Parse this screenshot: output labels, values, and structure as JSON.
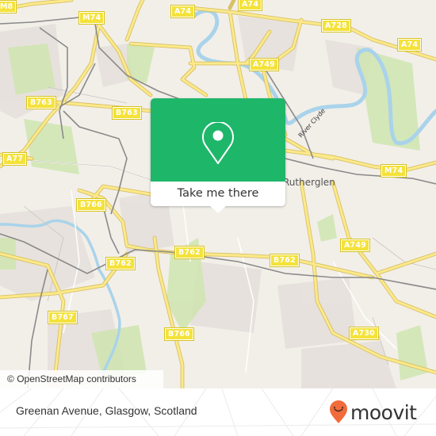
{
  "map": {
    "place_labels": [
      {
        "id": "rutherglen",
        "text": "Rutherglen"
      }
    ],
    "river_label": "River Clyde",
    "road_labels": [
      {
        "id": "m8",
        "text": "M8"
      },
      {
        "id": "m74-north",
        "text": "M74"
      },
      {
        "id": "a74-top-left",
        "text": "A74"
      },
      {
        "id": "a74-top-mid",
        "text": "A74"
      },
      {
        "id": "a728",
        "text": "A728"
      },
      {
        "id": "a74-right",
        "text": "A74"
      },
      {
        "id": "a749-top",
        "text": "A749"
      },
      {
        "id": "b763-left",
        "text": "B763"
      },
      {
        "id": "b763-mid",
        "text": "B763"
      },
      {
        "id": "a77",
        "text": "A77"
      },
      {
        "id": "m74-east",
        "text": "M74"
      },
      {
        "id": "b766-top",
        "text": "B766"
      },
      {
        "id": "b762-left",
        "text": "B762"
      },
      {
        "id": "b762-mid",
        "text": "B762"
      },
      {
        "id": "b762-right",
        "text": "B762"
      },
      {
        "id": "a749-right",
        "text": "A749"
      },
      {
        "id": "b767",
        "text": "B767"
      },
      {
        "id": "b766-bottom",
        "text": "B766"
      },
      {
        "id": "a730",
        "text": "A730"
      }
    ],
    "attribution": {
      "prefix": "© ",
      "text": "OpenStreetMap contributors"
    }
  },
  "popup": {
    "icon": "map-pin-icon",
    "button_label": "Take me there",
    "accent_color": "#1eb76a"
  },
  "footer": {
    "address": "Greenan Avenue, Glasgow, Scotland",
    "brand": "moovit",
    "brand_color": "#f26b3a"
  }
}
